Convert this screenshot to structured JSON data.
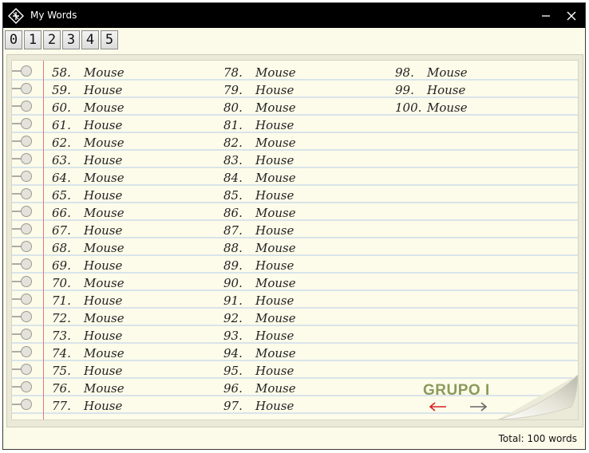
{
  "window": {
    "title": "My Words"
  },
  "tabs": [
    "0",
    "1",
    "2",
    "3",
    "4",
    "5"
  ],
  "columns": [
    {
      "entries": [
        {
          "num": "58.",
          "word": "Mouse"
        },
        {
          "num": "59.",
          "word": "House"
        },
        {
          "num": "60.",
          "word": "Mouse"
        },
        {
          "num": "61.",
          "word": "House"
        },
        {
          "num": "62.",
          "word": "Mouse"
        },
        {
          "num": "63.",
          "word": "House"
        },
        {
          "num": "64.",
          "word": "Mouse"
        },
        {
          "num": "65.",
          "word": "House"
        },
        {
          "num": "66.",
          "word": "Mouse"
        },
        {
          "num": "67.",
          "word": "House"
        },
        {
          "num": "68.",
          "word": "Mouse"
        },
        {
          "num": "69.",
          "word": "House"
        },
        {
          "num": "70.",
          "word": "Mouse"
        },
        {
          "num": "71.",
          "word": "House"
        },
        {
          "num": "72.",
          "word": "Mouse"
        },
        {
          "num": "73.",
          "word": "House"
        },
        {
          "num": "74.",
          "word": "Mouse"
        },
        {
          "num": "75.",
          "word": "House"
        },
        {
          "num": "76.",
          "word": "Mouse"
        },
        {
          "num": "77.",
          "word": "House"
        }
      ]
    },
    {
      "entries": [
        {
          "num": "78.",
          "word": "Mouse"
        },
        {
          "num": "79.",
          "word": "House"
        },
        {
          "num": "80.",
          "word": "Mouse"
        },
        {
          "num": "81.",
          "word": "House"
        },
        {
          "num": "82.",
          "word": "Mouse"
        },
        {
          "num": "83.",
          "word": "House"
        },
        {
          "num": "84.",
          "word": "Mouse"
        },
        {
          "num": "85.",
          "word": "House"
        },
        {
          "num": "86.",
          "word": "Mouse"
        },
        {
          "num": "87.",
          "word": "House"
        },
        {
          "num": "88.",
          "word": "Mouse"
        },
        {
          "num": "89.",
          "word": "House"
        },
        {
          "num": "90.",
          "word": "Mouse"
        },
        {
          "num": "91.",
          "word": "House"
        },
        {
          "num": "92.",
          "word": "Mouse"
        },
        {
          "num": "93.",
          "word": "House"
        },
        {
          "num": "94.",
          "word": "Mouse"
        },
        {
          "num": "95.",
          "word": "House"
        },
        {
          "num": "96.",
          "word": "Mouse"
        },
        {
          "num": "97.",
          "word": "House"
        }
      ]
    },
    {
      "entries": [
        {
          "num": "98.",
          "word": "Mouse"
        },
        {
          "num": "99.",
          "word": "House"
        },
        {
          "num": "100.",
          "word": "Mouse"
        }
      ]
    }
  ],
  "group_label": "GRUPO I",
  "nav": {
    "prev_icon": "arrow-left-icon",
    "next_icon": "arrow-right-icon"
  },
  "status": {
    "total": "Total: 100 words"
  },
  "colors": {
    "paper": "#fdfcea",
    "rule_line": "#c4d6ea",
    "margin_line": "#e07a7a",
    "group_label": "#8a9a5b",
    "prev_arrow": "#d62020",
    "next_arrow": "#666666"
  }
}
